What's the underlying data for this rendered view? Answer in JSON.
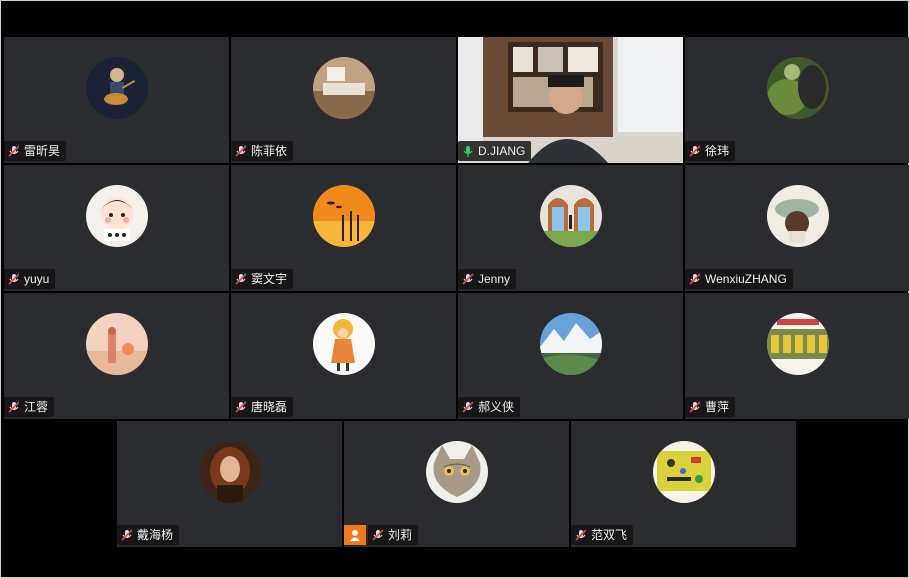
{
  "participants": [
    {
      "name": "雷昕昊",
      "mic": "muted"
    },
    {
      "name": "陈菲依",
      "mic": "muted"
    },
    {
      "name": "D.JIANG",
      "mic": "speaking",
      "video": true
    },
    {
      "name": "徐玮",
      "mic": "muted"
    },
    {
      "name": "yuyu",
      "mic": "muted"
    },
    {
      "name": "窦文宇",
      "mic": "muted"
    },
    {
      "name": "Jenny",
      "mic": "muted"
    },
    {
      "name": "WenxiuZHANG",
      "mic": "muted"
    },
    {
      "name": "江蓉",
      "mic": "muted"
    },
    {
      "name": "唐晓磊",
      "mic": "muted"
    },
    {
      "name": "郝义侠",
      "mic": "muted"
    },
    {
      "name": "曹萍",
      "mic": "muted"
    },
    {
      "name": "戴海杨",
      "mic": "muted"
    },
    {
      "name": "刘莉",
      "mic": "muted",
      "self": true
    },
    {
      "name": "范双飞",
      "mic": "muted"
    }
  ],
  "colors": {
    "tile_bg": "#2b2c2f",
    "active_border": "#1aa36b",
    "muted_icon": "#e04545",
    "speaking_icon": "#2ecc71",
    "self_badge": "#f07b1a"
  }
}
